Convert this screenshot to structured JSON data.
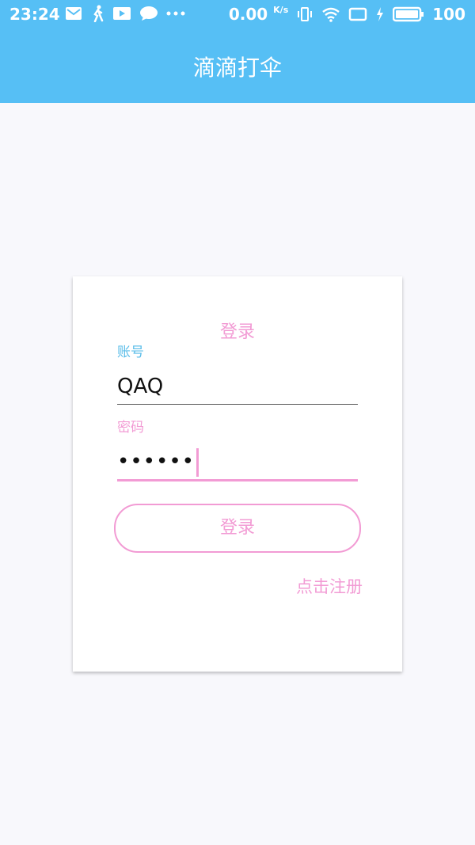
{
  "status_bar": {
    "time": "23:24",
    "icons": [
      "mail-icon",
      "walk-icon",
      "play-icon",
      "chat-icon",
      "more-icon"
    ],
    "net_speed": "0.00",
    "net_speed_unit": "K/s",
    "battery": "100"
  },
  "app_bar": {
    "title": "滴滴打伞"
  },
  "login_card": {
    "title": "登录",
    "username_label": "账号",
    "username_value": "QAQ",
    "password_label": "密码",
    "password_value": "••••••",
    "login_button": "登录",
    "register_link": "点击注册"
  },
  "colors": {
    "primary": "#56bff5",
    "accent_pink": "#f29bd4",
    "label_blue": "#5bbde9"
  }
}
